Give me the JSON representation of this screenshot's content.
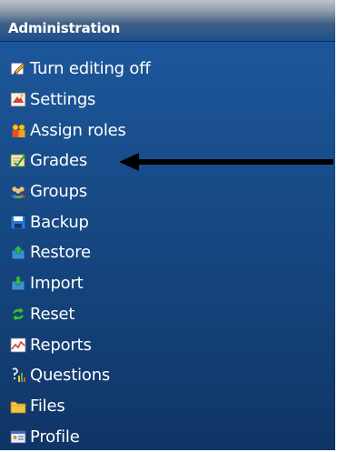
{
  "header": {
    "title": "Administration"
  },
  "menu": {
    "items": [
      {
        "label": "Turn editing off",
        "icon": "edit-icon"
      },
      {
        "label": "Settings",
        "icon": "settings-icon"
      },
      {
        "label": "Assign roles",
        "icon": "roles-icon"
      },
      {
        "label": "Grades",
        "icon": "grades-icon"
      },
      {
        "label": "Groups",
        "icon": "groups-icon"
      },
      {
        "label": "Backup",
        "icon": "backup-icon"
      },
      {
        "label": "Restore",
        "icon": "restore-icon"
      },
      {
        "label": "Import",
        "icon": "import-icon"
      },
      {
        "label": "Reset",
        "icon": "reset-icon"
      },
      {
        "label": "Reports",
        "icon": "reports-icon"
      },
      {
        "label": "Questions",
        "icon": "questions-icon"
      },
      {
        "label": "Files",
        "icon": "folder-icon"
      },
      {
        "label": "Profile",
        "icon": "profile-icon"
      }
    ]
  },
  "annotation": {
    "arrow_target": "Grades",
    "icon": "pointing-arrow-icon"
  },
  "colors": {
    "panel_top": "#1e5aa0",
    "panel_bottom": "#103566",
    "header_light": "#b9c3cd",
    "text": "#ffffff",
    "arrow": "#000000"
  }
}
